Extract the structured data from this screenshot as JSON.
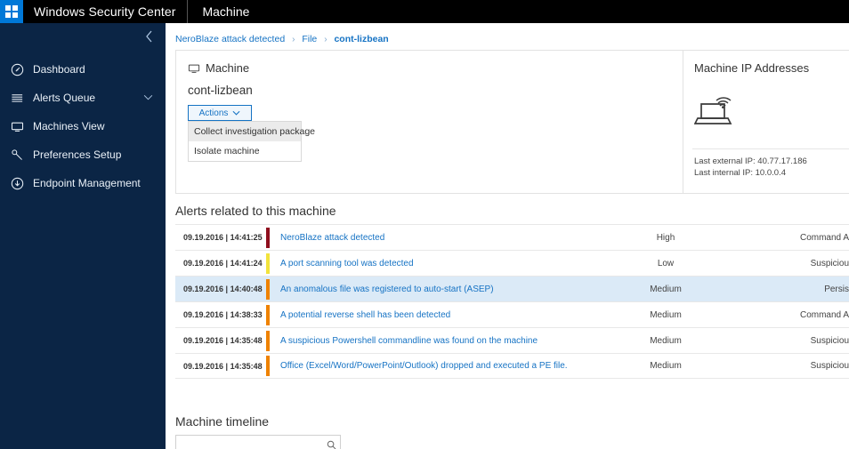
{
  "header": {
    "brand": "Windows Security Center",
    "page_title": "Machine",
    "logo_icon": "windows-logo-icon",
    "accent_color": "#0078d7",
    "background_color": "#000000"
  },
  "sidebar": {
    "background_color": "#0b2545",
    "collapse_icon": "chevron-left-icon",
    "items": [
      {
        "label": "Dashboard",
        "icon": "dashboard-gauge-icon",
        "expandable": false
      },
      {
        "label": "Alerts Queue",
        "icon": "list-lines-icon",
        "expandable": true,
        "chevron": "chevron-down-icon"
      },
      {
        "label": "Machines View",
        "icon": "monitor-icon",
        "expandable": false
      },
      {
        "label": "Preferences Setup",
        "icon": "wrench-icon",
        "expandable": false
      },
      {
        "label": "Endpoint Management",
        "icon": "download-circle-icon",
        "expandable": false
      }
    ]
  },
  "breadcrumb": {
    "separator": "›",
    "items": [
      {
        "label": "NeroBlaze attack detected",
        "current": false
      },
      {
        "label": "File",
        "current": false
      },
      {
        "label": "cont-lizbean",
        "current": true
      }
    ]
  },
  "machine_card": {
    "heading": "Machine",
    "heading_icon": "monitor-icon",
    "machine_name": "cont-lizbean",
    "actions_button": {
      "label": "Actions",
      "caret_icon": "chevron-down-icon",
      "expanded": true,
      "border_color": "#1673c4"
    },
    "dropdown_items": [
      {
        "label": "Collect investigation package",
        "hovered": true
      },
      {
        "label": "Isolate machine",
        "hovered": false
      }
    ]
  },
  "ip_card": {
    "title": "Machine IP Addresses",
    "icon": "laptop-wireless-icon",
    "last_external_ip_label": "Last external IP: 40.77.17.186",
    "last_internal_ip_label": "Last internal IP: 10.0.0.4"
  },
  "alerts_section": {
    "title": "Alerts related to this machine",
    "severity_colors": {
      "High": "#8f0e1e",
      "Medium": "#ef8200",
      "Low": "#f2e33c"
    },
    "rows": [
      {
        "timestamp": "09.19.2016 | 14:41:25",
        "title": "NeroBlaze attack detected",
        "severity": "High",
        "severity_color": "#8f0e1e",
        "category": "Command A",
        "selected": false
      },
      {
        "timestamp": "09.19.2016 | 14:41:24",
        "title": "A port scanning tool was detected",
        "severity": "Low",
        "severity_color": "#f2e33c",
        "category": "Suspiciou",
        "selected": false
      },
      {
        "timestamp": "09.19.2016 | 14:40:48",
        "title": "An anomalous file was registered to auto-start (ASEP)",
        "severity": "Medium",
        "severity_color": "#ef8200",
        "category": "Persis",
        "selected": true
      },
      {
        "timestamp": "09.19.2016 | 14:38:33",
        "title": "A potential reverse shell has been detected",
        "severity": "Medium",
        "severity_color": "#ef8200",
        "category": "Command A",
        "selected": false
      },
      {
        "timestamp": "09.19.2016 | 14:35:48",
        "title": "A suspicious Powershell commandline was found on the machine",
        "severity": "Medium",
        "severity_color": "#ef8200",
        "category": "Suspiciou",
        "selected": false
      },
      {
        "timestamp": "09.19.2016 | 14:35:48",
        "title": "Office (Excel/Word/PowerPoint/Outlook) dropped and executed a PE file.",
        "severity": "Medium",
        "severity_color": "#ef8200",
        "category": "Suspiciou",
        "selected": false
      }
    ]
  },
  "timeline_section": {
    "title": "Machine timeline",
    "search_value": "",
    "search_placeholder": "",
    "search_icon": "search-icon"
  }
}
